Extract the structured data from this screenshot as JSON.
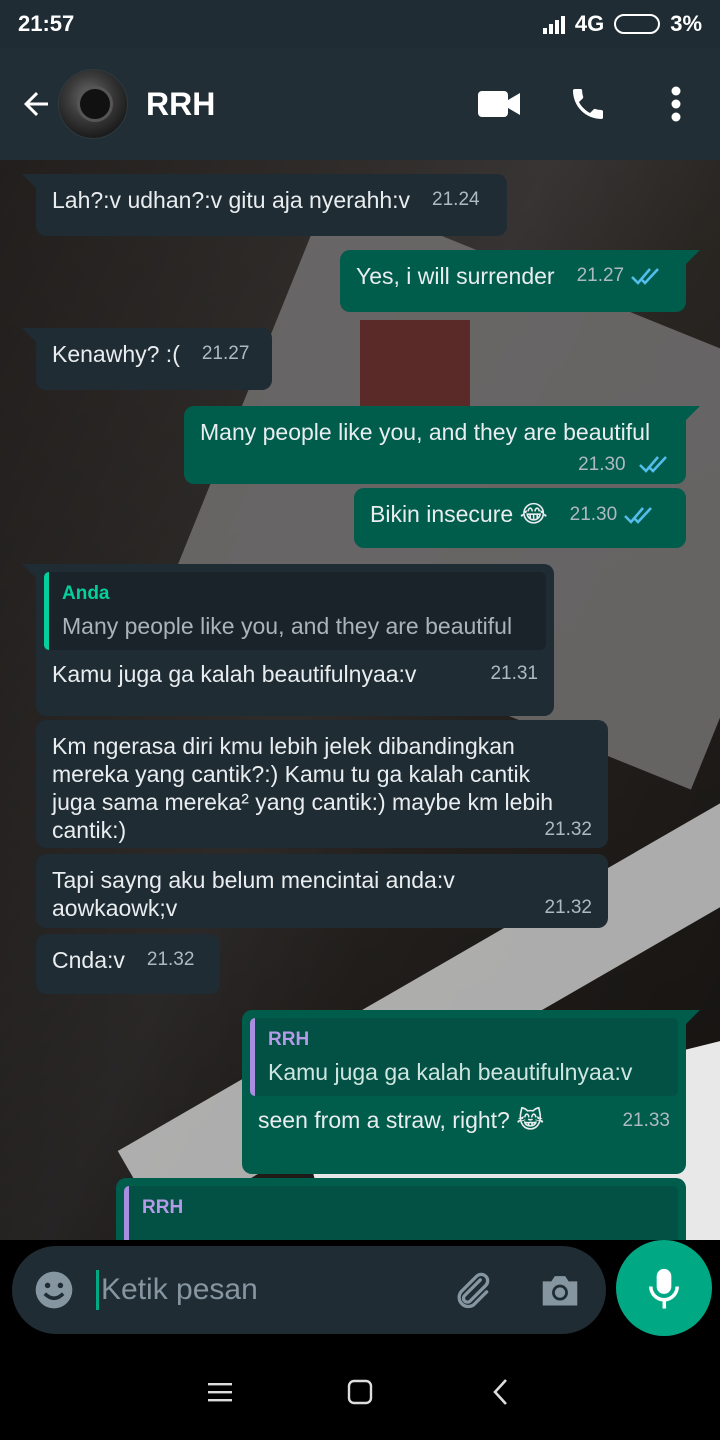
{
  "status_bar": {
    "time": "21:57",
    "network": "4G",
    "battery": "3%"
  },
  "header": {
    "contact_name": "RRH"
  },
  "messages": [
    {
      "dir": "in",
      "text": "Lah?:v udhan?:v gitu aja nyerahh:v",
      "time": "21.24"
    },
    {
      "dir": "out",
      "text": "Yes, i will surrender",
      "time": "21.27",
      "ticks": "read"
    },
    {
      "dir": "in",
      "text": "Kenawhy? :(",
      "time": "21.27"
    },
    {
      "dir": "out",
      "text": "Many people like you, and they are beautiful",
      "time": "21.30",
      "ticks": "read"
    },
    {
      "dir": "out",
      "text": "Bikin insecure",
      "emoji": "😂",
      "time": "21.30",
      "ticks": "read"
    },
    {
      "dir": "in",
      "quote_author": "Anda",
      "quote_text": "Many people like you, and they are beautiful",
      "text": "Kamu juga ga kalah beautifulnyaa:v",
      "time": "21.31"
    },
    {
      "dir": "in",
      "lines": [
        "Km ngerasa diri kmu lebih jelek dibandingkan",
        "mereka yang cantik?:) Kamu tu ga kalah cantik",
        "juga sama mereka² yang cantik:) maybe km lebih",
        "cantik:)"
      ],
      "time": "21.32"
    },
    {
      "dir": "in",
      "lines": [
        "Tapi sayng aku belum mencintai anda:v",
        "aowkaowk;v"
      ],
      "time": "21.32"
    },
    {
      "dir": "in",
      "text": "Cnda:v",
      "time": "21.32"
    },
    {
      "dir": "out",
      "quote_author": "RRH",
      "quote_text": "Kamu juga ga kalah beautifulnyaa:v",
      "text": "seen from a straw, right?",
      "emoji": "😹",
      "time": "21.33"
    },
    {
      "dir": "out",
      "quote_author": "RRH"
    }
  ],
  "input": {
    "placeholder": "Ketik pesan"
  },
  "colors": {
    "incoming": "#1f2c34",
    "outgoing": "#005c4b",
    "accent": "#00a884",
    "read_ticks": "#53bdeb"
  },
  "icons": [
    "back-arrow-icon",
    "video-call-icon",
    "voice-call-icon",
    "more-options-icon",
    "emoji-icon",
    "attach-icon",
    "camera-icon",
    "mic-icon",
    "scroll-down-icon",
    "nav-menu-icon",
    "nav-home-icon",
    "nav-back-icon"
  ]
}
